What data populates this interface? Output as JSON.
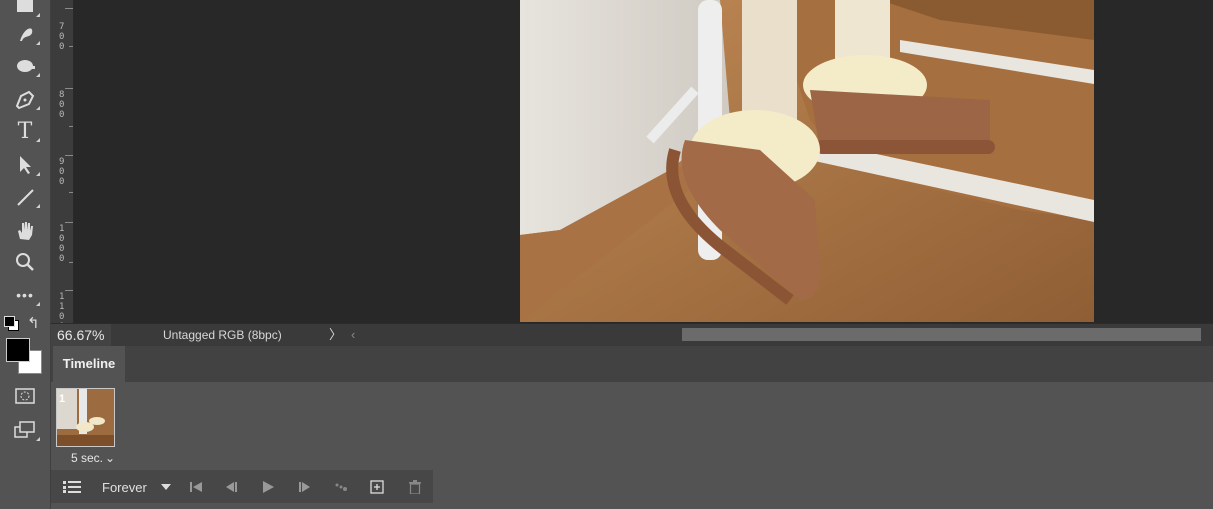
{
  "toolbar": {
    "tools": [
      "gradient-tool",
      "smudge-tool",
      "dodge-tool",
      "pen-tool",
      "type-tool",
      "path-selection-tool",
      "line-tool",
      "hand-tool",
      "zoom-tool",
      "more-tools"
    ],
    "type_tool_glyph": "T",
    "more_glyph": "•••"
  },
  "ruler": {
    "marks": [
      "700",
      "800",
      "900",
      "1000",
      "1100"
    ]
  },
  "status": {
    "zoom": "66.67%",
    "profile": "Untagged RGB (8bpc)",
    "expand_arrow": "〉",
    "scroll_left_arrow": "‹"
  },
  "timeline": {
    "tab_label": "Timeline",
    "frame_number": "1",
    "frame_delay": "5 sec.",
    "frame_delay_arrow": "⌄",
    "loop_option": "Forever"
  },
  "colors": {
    "foreground": "#000000",
    "background": "#ffffff",
    "ui_background": "#535353",
    "canvas_background": "#282828"
  }
}
